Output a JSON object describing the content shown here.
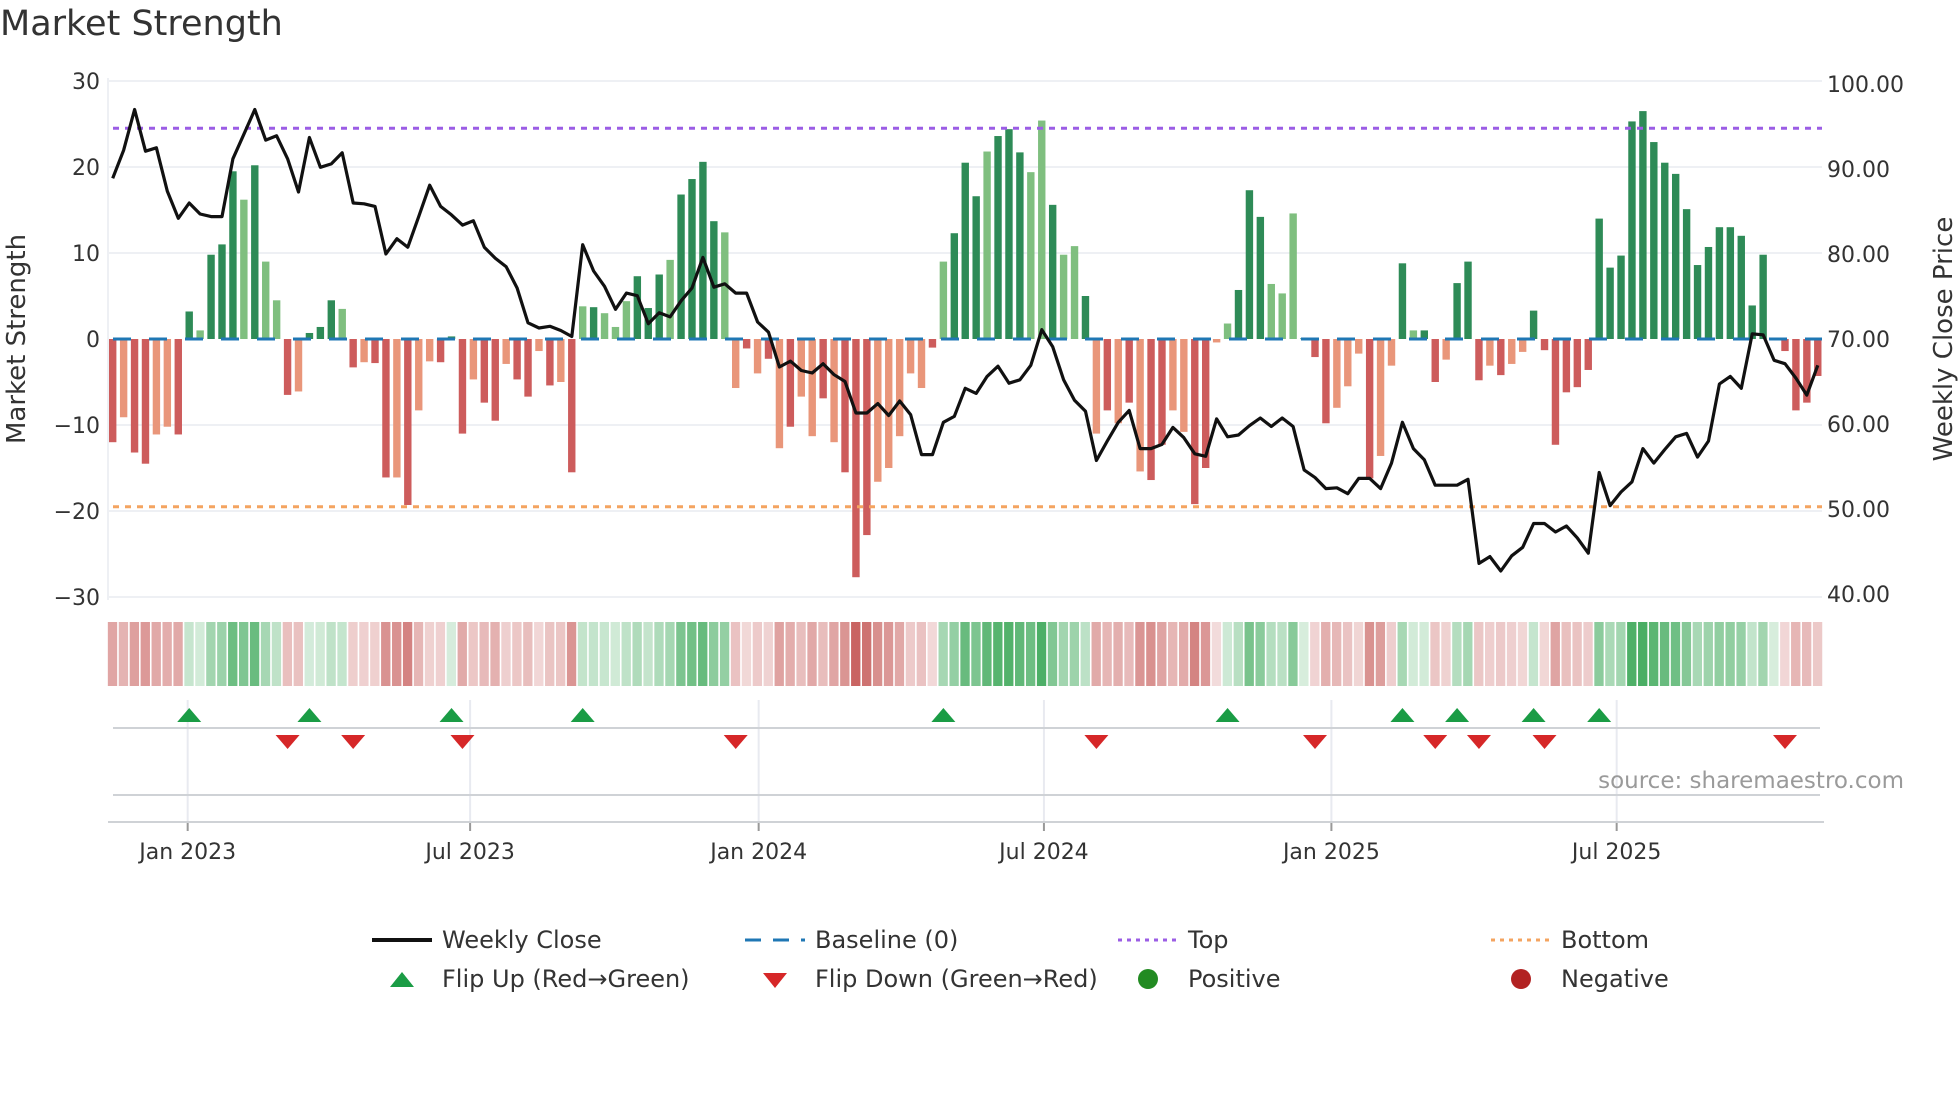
{
  "title": "Market Strength",
  "source": "source: sharemaestro.com",
  "legend": {
    "weekly_close": "Weekly Close",
    "baseline": "Baseline (0)",
    "top": "Top",
    "bottom": "Bottom",
    "flip_up": "Flip Up (Red→Green)",
    "flip_down": "Flip Down (Green→Red)",
    "positive": "Positive",
    "negative": "Negative"
  },
  "colors": {
    "pos_dark": "#2e8b57",
    "pos_light": "#7fbf7f",
    "neg_dark": "#cd5c5c",
    "neg_light": "#e9967a",
    "close": "#111111",
    "baseline": "#1f77b4",
    "top": "#9b5de5",
    "bottom": "#f4a460",
    "flip_up": "#1a9c45",
    "flip_down": "#d62728",
    "positive": "#228b22",
    "negative": "#b22222",
    "strip_pos": "#4aae64",
    "strip_neg": "#c96462"
  },
  "chart_data": {
    "type": "bar+line",
    "title": "Market Strength",
    "ylabel": "Market Strength",
    "y2label": "Weekly Close Price",
    "ylim": [
      -30,
      30
    ],
    "y2lim": [
      40,
      100
    ],
    "yticks": [
      "30",
      "20",
      "10",
      "0",
      "−10",
      "−20",
      "−30"
    ],
    "ytick_values": [
      30,
      20,
      10,
      0,
      -10,
      -20,
      -30
    ],
    "y2ticks": [
      "100.00",
      "90.00",
      "80.00",
      "70.00",
      "60.00",
      "50.00",
      "40.00"
    ],
    "y2tick_values": [
      100,
      90,
      80,
      70,
      60,
      50,
      40
    ],
    "xticks": [
      {
        "label": "Jan 2023",
        "week": 7.86
      },
      {
        "label": "Jul 2023",
        "week": 33.7
      },
      {
        "label": "Jan 2024",
        "week": 60.1
      },
      {
        "label": "Jul 2024",
        "week": 86.2
      },
      {
        "label": "Jan 2025",
        "week": 112.5
      },
      {
        "label": "Jul 2025",
        "week": 138.6
      }
    ],
    "top_level": 24.5,
    "bottom_level": -19.5,
    "baseline": 0,
    "strength": [
      -12,
      -9.1,
      -13.2,
      -14.5,
      -11.1,
      -10.2,
      -11.1,
      3.2,
      1,
      9.8,
      11,
      19.5,
      16.2,
      20.2,
      9,
      4.5,
      -6.5,
      -6.1,
      0.7,
      1.4,
      4.5,
      3.5,
      -3.3,
      -2.7,
      -2.8,
      -16.1,
      -16.1,
      -19.3,
      -8.3,
      -2.6,
      -2.7,
      0.3,
      -11,
      -4.7,
      -7.4,
      -9.5,
      -2.9,
      -4.7,
      -6.7,
      -1.4,
      -5.4,
      -5,
      -15.5,
      3.8,
      3.7,
      3.0,
      1.4,
      4.4,
      7.3,
      3.6,
      7.5,
      9.2,
      16.8,
      18.6,
      20.6,
      13.7,
      12.4,
      -5.7,
      -1.1,
      -4,
      -2.3,
      -12.7,
      -10.2,
      -6.7,
      -11.3,
      -6.9,
      -12,
      -15.5,
      -27.7,
      -22.8,
      -16.6,
      -15,
      -11.3,
      -4,
      -5.7,
      -1,
      9,
      12.3,
      20.5,
      16.6,
      21.8,
      23.6,
      24.4,
      21.7,
      19.4,
      25.4,
      15.6,
      9.8,
      10.8,
      5,
      -11,
      -8.3,
      -9.8,
      -7.4,
      -15.4,
      -16.4,
      -12.3,
      -8.3,
      -10.8,
      -19.2,
      -15,
      -0.4,
      1.8,
      5.7,
      17.3,
      14.2,
      6.4,
      5.3,
      14.6,
      0.1,
      -2.1,
      -9.8,
      -8,
      -5.5,
      -1.7,
      -16.2,
      -13.6,
      -3.1,
      8.8,
      1,
      1,
      -5,
      -2.4,
      6.5,
      9,
      -4.8,
      -3.1,
      -4.2,
      -2.9,
      -1.5,
      3.3,
      -1.3,
      -12.3,
      -6.2,
      -5.6,
      -3.6,
      14,
      8.3,
      9.7,
      25.3,
      26.5,
      22.9,
      20.5,
      19.2,
      15.1,
      8.6,
      10.7,
      13,
      13,
      12,
      3.9,
      9.8,
      0.1,
      -1.4,
      -8.3,
      -7.4,
      -4.3
    ],
    "shade": "dlddllddldddldlldldddldlddldlldddlddlddldldldllldddlddddlldldldlldldddllllldldddldddlldlldldldlddllddlldddllldddllldlldlddldddldllddd",
    "weekly_close": [
      88.9,
      92.2,
      97,
      92.1,
      92.5,
      87.4,
      84.2,
      86,
      84.7,
      84.4,
      84.4,
      91.2,
      94.1,
      97,
      93.4,
      93.9,
      91.2,
      87.3,
      93.7,
      90.2,
      90.6,
      91.9,
      86,
      85.9,
      85.6,
      80,
      81.8,
      80.8,
      84.4,
      88.1,
      85.6,
      84.6,
      83.4,
      83.9,
      80.8,
      79.5,
      78.5,
      76,
      71.9,
      71.3,
      71.5,
      71,
      70.3,
      81.1,
      78,
      76.2,
      73.5,
      75.4,
      75.1,
      71.8,
      73.1,
      72.6,
      74.5,
      76,
      79.6,
      76.1,
      76.5,
      75.4,
      75.4,
      72,
      70.8,
      66.7,
      67.4,
      66.3,
      66,
      67.1,
      65.8,
      65,
      61.3,
      61.3,
      62.4,
      61,
      62.7,
      61.1,
      56.4,
      56.4,
      60.2,
      60.9,
      64.2,
      63.6,
      65.6,
      66.8,
      64.8,
      65.2,
      66.9,
      71.1,
      69.1,
      65.2,
      62.8,
      61.5,
      55.7,
      58,
      60.2,
      61.6,
      57.1,
      57.1,
      57.6,
      59.6,
      58.4,
      56.5,
      56.2,
      60.6,
      58.5,
      58.7,
      59.8,
      60.7,
      59.7,
      60.7,
      59.7,
      54.6,
      53.7,
      52.4,
      52.5,
      51.8,
      53.6,
      53.6,
      52.4,
      55.4,
      60.2,
      57.1,
      55.8,
      52.8,
      52.8,
      52.8,
      53.5,
      43.6,
      44.4,
      42.7,
      44.5,
      45.5,
      48.3,
      48.3,
      47.3,
      48,
      46.6,
      44.8,
      54.3,
      50.4,
      52,
      53.2,
      57.1,
      55.4,
      57,
      58.5,
      58.9,
      56.1,
      58,
      64.7,
      65.6,
      64.2,
      70.6,
      70.5,
      67.5,
      67.1,
      65.4,
      63.4,
      66.9
    ],
    "flip_up_weeks": [
      8,
      19,
      32,
      44,
      77,
      103,
      119,
      124,
      131,
      137
    ],
    "flip_down_weeks": [
      17,
      23,
      33,
      58,
      91,
      111,
      122,
      126,
      132,
      154
    ]
  }
}
